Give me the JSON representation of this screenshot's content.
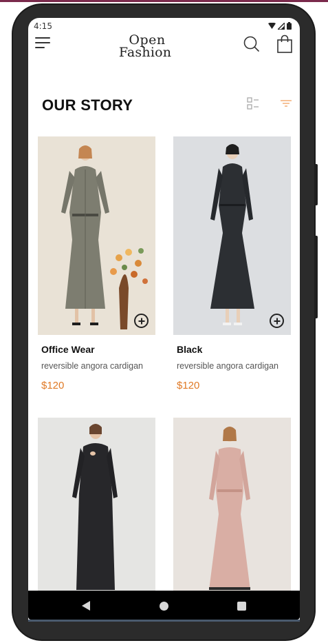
{
  "status_bar": {
    "time": "4:15"
  },
  "header": {
    "logo_line1": "Open",
    "logo_line2": "Fashion",
    "icons": [
      "menu-icon",
      "search-icon",
      "shopping-bag-icon"
    ]
  },
  "section": {
    "title": "OUR STORY",
    "icons": [
      "list-view-icon",
      "filter-icon"
    ],
    "accent_color": "#e07a26"
  },
  "products": [
    {
      "name": "Office Wear",
      "description": "reversible angora cardigan",
      "price": "$120",
      "image": "grey-dress-photo"
    },
    {
      "name": "Black",
      "description": "reversible angora cardigan",
      "price": "$120",
      "image": "black-dress-photo"
    },
    {
      "name": "",
      "description": "",
      "price": "",
      "image": "black-midi-dress-photo"
    },
    {
      "name": "",
      "description": "",
      "price": "",
      "image": "pink-dress-photo"
    }
  ],
  "nav": {
    "icons": [
      "back-icon",
      "home-icon",
      "recents-icon"
    ]
  }
}
